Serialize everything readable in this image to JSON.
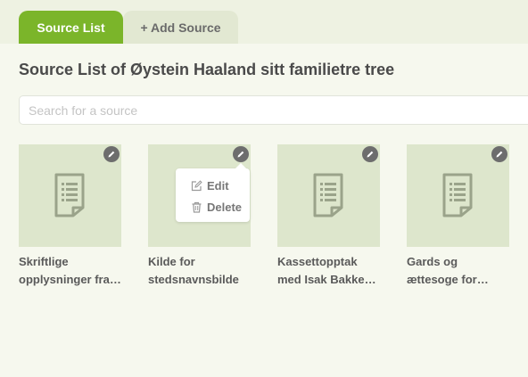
{
  "tabs": {
    "source_list": "Source List",
    "add_source": "+ Add Source"
  },
  "page_title": "Source List of Øystein Haaland sitt familietre tree",
  "search": {
    "placeholder": "Search for a source",
    "value": ""
  },
  "sources": [
    {
      "title_line1": "Skriftlige",
      "title_line2": "opplysninger fra…"
    },
    {
      "title_line1": "Kilde for",
      "title_line2": "stedsnavnsbilde"
    },
    {
      "title_line1": "Kassettopptak",
      "title_line2": "med Isak Bakke…"
    },
    {
      "title_line1": "Gards og",
      "title_line2": "ættesoge for…"
    }
  ],
  "context_menu": {
    "edit_label": "Edit",
    "delete_label": "Delete"
  },
  "icons": {
    "card_thumbnail": "document-icon",
    "card_action": "pencil-icon",
    "menu_edit": "edit-icon",
    "menu_delete": "trash-icon"
  },
  "colors": {
    "accent": "#7bb52a",
    "page_bg": "#f6f8ee",
    "thumb_bg": "#dde6cc",
    "icon_gray": "#9aa38a"
  }
}
